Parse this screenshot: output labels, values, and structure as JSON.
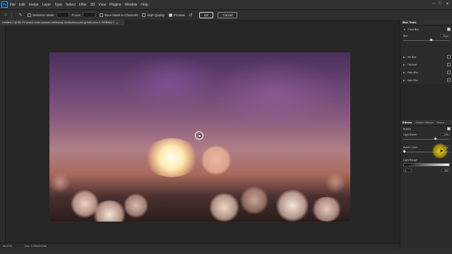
{
  "menubar": {
    "logo": "Ps",
    "items": [
      "File",
      "Edit",
      "Image",
      "Layer",
      "Type",
      "Select",
      "Filter",
      "3D",
      "View",
      "Plugins",
      "Window",
      "Help"
    ],
    "window_controls": [
      "–",
      "□",
      "✕"
    ]
  },
  "options": {
    "selection_mask_label": "Selection Mask",
    "focus_label": "Focus",
    "save_mask_label": "Save Mask to Channels",
    "high_quality_label": "High Quality",
    "preview_label": "Preview",
    "ok_label": "OK",
    "cancel_label": "Cancel",
    "preview_checked": true
  },
  "document": {
    "tab_title": "Untitled-1 @ 66.7% (sokol-nolar-vosman-ndertanay-lnvrtuchous-pair-gradle envz.1, RGB/8#) *",
    "close_symbol": "✕"
  },
  "status": {
    "zoom": "66.67%",
    "doc_info": "Doc: 5.93M/5.93M"
  },
  "panels": {
    "blur_tools": {
      "title": "Blur Tools",
      "items": [
        {
          "label": "Field Blur",
          "checked": true,
          "expanded": true
        },
        {
          "label": "Iris Blur",
          "checked": false,
          "expanded": false
        },
        {
          "label": "Tilt-Shift",
          "checked": false,
          "expanded": false
        },
        {
          "label": "Path Blur",
          "checked": false,
          "expanded": false
        },
        {
          "label": "Spin Blur",
          "checked": false,
          "expanded": false
        }
      ],
      "blur_label": "Blur:",
      "blur_value": "78 px",
      "blur_level": 0.6
    },
    "effects": {
      "tabs": [
        "Effects",
        "Motion Effects",
        "Noise"
      ],
      "active_tab": "Effects",
      "bokeh_label": "Bokeh",
      "bokeh_checked": true,
      "light_bokeh_label": "Light Bokeh:",
      "light_bokeh_value": "70%",
      "light_bokeh_level": 0.7,
      "bokeh_color_label": "Bokeh Color:",
      "bokeh_color_value": "0%",
      "bokeh_color_level": 0.0,
      "light_range_label": "Light Range:",
      "light_range_low": "0",
      "light_range_high": "255"
    }
  }
}
